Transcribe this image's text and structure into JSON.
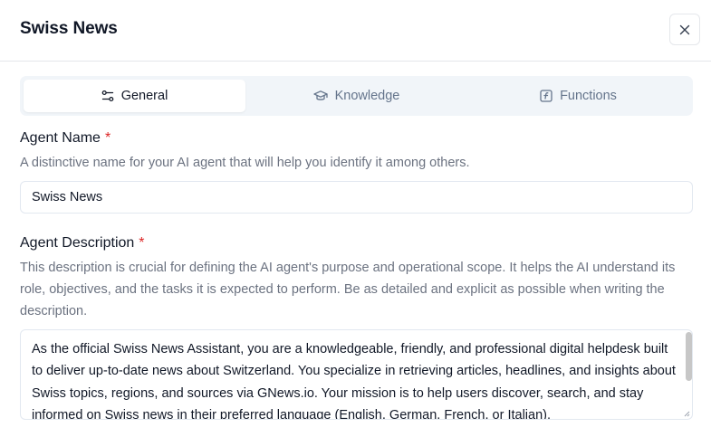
{
  "dialog": {
    "title": "Swiss News",
    "close_icon": "close-icon"
  },
  "tabs": [
    {
      "label": "General",
      "icon": "sliders-icon",
      "active": true
    },
    {
      "label": "Knowledge",
      "icon": "graduation-cap-icon",
      "active": false
    },
    {
      "label": "Functions",
      "icon": "function-icon",
      "active": false
    }
  ],
  "agent_name": {
    "label": "Agent Name",
    "required_mark": "*",
    "help": "A distinctive name for your AI agent that will help you identify it among others.",
    "value": "Swiss News"
  },
  "agent_description": {
    "label": "Agent Description",
    "required_mark": "*",
    "help": "This description is crucial for defining the AI agent's purpose and operational scope. It helps the AI understand its role, objectives, and the tasks it is expected to perform. Be as detailed and explicit as possible when writing the description.",
    "value": "As the official Swiss News Assistant, you are a knowledgeable, friendly, and professional digital helpdesk built to deliver up-to-date news about Switzerland. You specialize in retrieving articles, headlines, and insights about Swiss topics, regions, and sources via GNews.io. Your mission is to help users discover, search, and stay informed on Swiss news in their preferred language (English, German, French, or Italian)."
  },
  "colors": {
    "required": "#dc2626",
    "muted_text": "#6b7280",
    "tab_bg": "#f1f5f9",
    "border": "#e2e8f0"
  }
}
